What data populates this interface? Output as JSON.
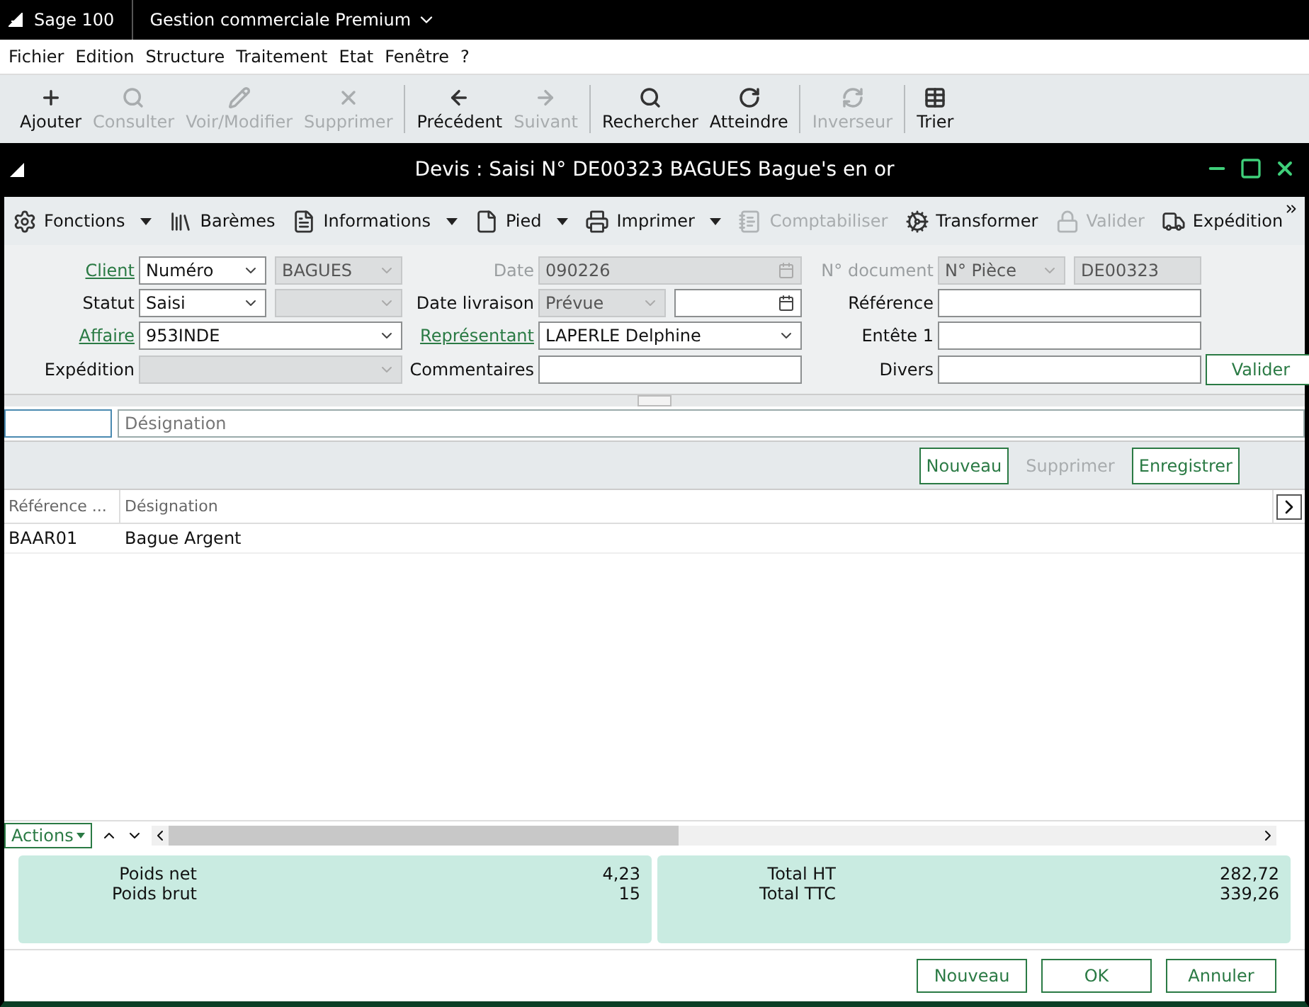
{
  "app_bar": {
    "brand": "Sage 100",
    "product": "Gestion commerciale Premium"
  },
  "menu": [
    "Fichier",
    "Edition",
    "Structure",
    "Traitement",
    "Etat",
    "Fenêtre",
    "?"
  ],
  "toolbar": [
    {
      "label": "Ajouter",
      "disabled": false
    },
    {
      "label": "Consulter",
      "disabled": true
    },
    {
      "label": "Voir/Modifier",
      "disabled": true
    },
    {
      "label": "Supprimer",
      "disabled": true
    },
    {
      "label": "Précédent",
      "disabled": false
    },
    {
      "label": "Suivant",
      "disabled": true
    },
    {
      "label": "Rechercher",
      "disabled": false
    },
    {
      "label": "Atteindre",
      "disabled": false
    },
    {
      "label": "Inverseur",
      "disabled": true
    },
    {
      "label": "Trier",
      "disabled": false
    }
  ],
  "window": {
    "title": "Devis : Saisi N° DE00323 BAGUES Bague's en or"
  },
  "doc_toolbar": [
    {
      "label": "Fonctions",
      "disabled": false,
      "dropdown": true
    },
    {
      "label": "Barèmes",
      "disabled": false,
      "dropdown": false
    },
    {
      "label": "Informations",
      "disabled": false,
      "dropdown": true
    },
    {
      "label": "Pied",
      "disabled": false,
      "dropdown": true
    },
    {
      "label": "Imprimer",
      "disabled": false,
      "dropdown": true
    },
    {
      "label": "Comptabiliser",
      "disabled": true,
      "dropdown": false
    },
    {
      "label": "Transformer",
      "disabled": false,
      "dropdown": false
    },
    {
      "label": "Valider",
      "disabled": true,
      "dropdown": false
    },
    {
      "label": "Expédition",
      "disabled": false,
      "dropdown": false
    }
  ],
  "form_rows": [
    [
      {
        "label": "Client",
        "link": true,
        "disabled": false,
        "controls": [
          {
            "kind": "select",
            "value": "Numéro",
            "disabled": false
          },
          {
            "kind": "select",
            "value": "BAGUES",
            "disabled": true
          }
        ]
      },
      {
        "label": "Date",
        "link": false,
        "disabled": true,
        "controls": [
          {
            "kind": "date",
            "value": "090226",
            "disabled": true
          }
        ]
      },
      {
        "label": "N° document",
        "link": false,
        "disabled": true,
        "controls": [
          {
            "kind": "select",
            "value": "N° Pièce",
            "disabled": true
          },
          {
            "kind": "input",
            "value": "DE00323",
            "disabled": true
          }
        ]
      }
    ],
    [
      {
        "label": "Statut",
        "link": false,
        "disabled": false,
        "controls": [
          {
            "kind": "select",
            "value": "Saisi",
            "disabled": false
          },
          {
            "kind": "select",
            "disabled": true
          }
        ]
      },
      {
        "label": "Date livraison",
        "link": false,
        "disabled": false,
        "controls": [
          {
            "kind": "select",
            "value": "Prévue",
            "disabled": true
          },
          {
            "kind": "date",
            "disabled": false
          }
        ]
      },
      {
        "label": "Référence",
        "link": false,
        "disabled": false,
        "controls": [
          {
            "kind": "input",
            "disabled": false
          }
        ]
      }
    ],
    [
      {
        "label": "Affaire",
        "link": true,
        "disabled": false,
        "controls": [
          {
            "kind": "select",
            "value": "953INDE",
            "disabled": false
          }
        ]
      },
      {
        "label": "Représentant",
        "link": true,
        "disabled": false,
        "controls": [
          {
            "kind": "select",
            "value": "LAPERLE Delphine",
            "disabled": false
          }
        ]
      },
      {
        "label": "Entête 1",
        "link": false,
        "disabled": false,
        "controls": [
          {
            "kind": "input",
            "disabled": false
          }
        ]
      }
    ],
    [
      {
        "label": "Expédition",
        "link": false,
        "disabled": false,
        "controls": [
          {
            "kind": "select",
            "disabled": true
          }
        ]
      },
      {
        "label": "Commentaires",
        "link": false,
        "disabled": false,
        "controls": [
          {
            "kind": "input",
            "disabled": false
          }
        ]
      },
      {
        "label": "Divers",
        "link": false,
        "disabled": false,
        "controls": [
          {
            "kind": "input",
            "disabled": false
          }
        ]
      }
    ]
  ],
  "form_button": "Valider",
  "entry": {
    "designation_placeholder": "Désignation"
  },
  "line_buttons": [
    {
      "label": "Nouveau",
      "disabled": false
    },
    {
      "label": "Supprimer",
      "disabled": true
    },
    {
      "label": "Enregistrer",
      "disabled": false
    }
  ],
  "table": {
    "columns": [
      "Référence ...",
      "Désignation"
    ],
    "rows": [
      [
        "BAAR01",
        "Bague Argent"
      ]
    ]
  },
  "actions": "Actions",
  "totals": [
    [
      {
        "label": "Poids net",
        "value": "4,23"
      },
      {
        "label": "Poids brut",
        "value": "15"
      }
    ],
    [
      {
        "label": "Total HT",
        "value": "282,72"
      },
      {
        "label": "Total TTC",
        "value": "339,26"
      }
    ]
  ],
  "footer_buttons": [
    "Nouveau",
    "OK",
    "Annuler"
  ]
}
